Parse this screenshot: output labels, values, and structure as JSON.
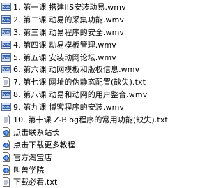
{
  "files": [
    {
      "name": "1. 第一课 搭建IIS安装动易.wmv",
      "icon": "wmv-file-icon"
    },
    {
      "name": "2. 第二课 动易的采集功能.wmv",
      "icon": "wmv-file-icon"
    },
    {
      "name": "3. 第三课 动易程序的安全.wmv",
      "icon": "wmv-file-icon"
    },
    {
      "name": "4. 第四课 动易模板管理.wmv",
      "icon": "wmv-file-icon"
    },
    {
      "name": "5. 第五课 安装动网论坛.wmv",
      "icon": "wmv-file-icon"
    },
    {
      "name": "6. 第六课 动网模板和版权信息.wmv",
      "icon": "wmv-file-icon"
    },
    {
      "name": "7. 第七课 网址的伪静态配置(缺失).txt",
      "icon": "txt-file-icon"
    },
    {
      "name": "8. 第八课 动易和动网的用户整合.wmv",
      "icon": "wmv-file-icon"
    },
    {
      "name": "9. 第九课 博客程序的安装.wmv",
      "icon": "wmv-file-icon"
    },
    {
      "name": "10. 第十课 Z-Blog程序的常用功能(缺失).txt",
      "icon": "txt-file-icon"
    },
    {
      "name": "点击联系站长",
      "icon": "url-shortcut-icon"
    },
    {
      "name": "点击下载更多教程",
      "icon": "url-shortcut-icon"
    },
    {
      "name": "官方淘宝店",
      "icon": "url-shortcut-icon"
    },
    {
      "name": "叫兽学院",
      "icon": "url-shortcut-icon"
    },
    {
      "name": "下载必看.txt",
      "icon": "txt-file-icon"
    }
  ]
}
